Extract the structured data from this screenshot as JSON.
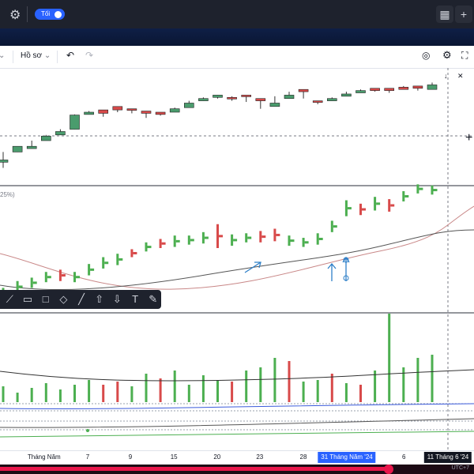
{
  "topbar": {
    "toggle_label": "Tối",
    "gear_icon": "gear-icon",
    "grid_icon": "grid-icon",
    "plus_icon": "plus-icon"
  },
  "toolbar": {
    "profile_label": "Hồ sơ",
    "undo_icon": "undo-icon",
    "redo_icon": "redo-icon"
  },
  "panel_label": "25%)",
  "drawing_tools": [
    "brush-icon",
    "comment-icon",
    "rectangle-icon",
    "diamond-icon",
    "line-icon",
    "arrow-up-icon",
    "arrow-down-icon",
    "text-icon",
    "pen-icon"
  ],
  "xaxis": {
    "labels": [
      {
        "text": "Tháng Năm",
        "pos": 0.093
      },
      {
        "text": "7",
        "pos": 0.185
      },
      {
        "text": "9",
        "pos": 0.275
      },
      {
        "text": "15",
        "pos": 0.367
      },
      {
        "text": "20",
        "pos": 0.458
      },
      {
        "text": "23",
        "pos": 0.548
      },
      {
        "text": "28",
        "pos": 0.64
      },
      {
        "text": "6",
        "pos": 0.852
      }
    ],
    "highlight1": "31 Tháng Năm '24",
    "highlight2": "11 Tháng 6 '24"
  },
  "bottom_text": "UTC+7",
  "colors": {
    "up": "#4caf50",
    "down": "#d84a4a",
    "dark": "#1e222d",
    "accent": "#2962ff",
    "progress": "#e8174b"
  },
  "chart_data": {
    "type": "bar",
    "candles_top": [
      [
        0.12,
        0.16,
        0.02,
        0.3
      ],
      [
        0.3,
        0.4,
        0.32,
        0.36
      ],
      [
        0.36,
        0.4,
        0.44,
        0.5
      ],
      [
        0.5,
        0.58,
        0.54,
        0.6
      ],
      [
        0.6,
        0.66,
        0.64,
        0.7
      ],
      [
        0.7,
        0.95,
        0.72,
        0.96
      ],
      [
        0.96,
        1.0,
        0.98,
        1.02
      ],
      [
        0.98,
        1.04,
        0.92,
        1.0
      ],
      [
        1.04,
        1.1,
        1.0,
        1.02
      ],
      [
        1.04,
        1.06,
        0.98,
        1.0
      ],
      [
        0.98,
        1.02,
        0.9,
        0.96
      ],
      [
        0.96,
        1.0,
        0.94,
        0.98
      ],
      [
        1.0,
        1.06,
        1.04,
        1.08
      ],
      [
        1.08,
        1.16,
        1.14,
        1.2
      ],
      [
        1.2,
        1.24,
        1.22,
        1.26
      ],
      [
        1.26,
        1.3,
        1.24,
        1.3
      ],
      [
        1.26,
        1.26,
        1.2,
        1.28
      ],
      [
        1.28,
        1.3,
        1.18,
        1.2
      ],
      [
        1.2,
        1.24,
        1.06,
        1.1
      ],
      [
        1.1,
        1.16,
        1.12,
        1.28
      ],
      [
        1.24,
        1.3,
        1.28,
        1.36
      ],
      [
        1.36,
        1.4,
        1.24,
        1.26
      ],
      [
        1.18,
        1.2,
        1.14,
        1.2
      ],
      [
        1.2,
        1.24,
        1.22,
        1.26
      ],
      [
        1.28,
        1.32,
        1.3,
        1.36
      ],
      [
        1.34,
        1.38,
        1.36,
        1.4
      ],
      [
        1.38,
        1.42,
        1.36,
        1.4
      ],
      [
        1.38,
        1.42,
        1.34,
        1.38
      ],
      [
        1.4,
        1.44,
        1.4,
        1.46
      ],
      [
        1.42,
        1.46,
        1.38,
        1.42
      ],
      [
        1.4,
        1.48,
        1.42,
        1.52
      ]
    ],
    "candles_top_colors": [
      "g",
      "g",
      "g",
      "g",
      "g",
      "g",
      "g",
      "r",
      "r",
      "r",
      "r",
      "r",
      "g",
      "g",
      "g",
      "g",
      "r",
      "r",
      "r",
      "g",
      "g",
      "r",
      "r",
      "g",
      "g",
      "g",
      "r",
      "r",
      "r",
      "r",
      "g"
    ],
    "hl_bottom": [
      [
        0.1,
        0.3,
        "g"
      ],
      [
        0.22,
        0.42,
        "g"
      ],
      [
        0.3,
        0.48,
        "g"
      ],
      [
        0.4,
        0.58,
        "g"
      ],
      [
        0.42,
        0.62,
        "r"
      ],
      [
        0.4,
        0.58,
        "g"
      ],
      [
        0.52,
        0.72,
        "g"
      ],
      [
        0.64,
        0.84,
        "g"
      ],
      [
        0.7,
        0.9,
        "g"
      ],
      [
        0.84,
        0.98,
        "r"
      ],
      [
        0.94,
        1.1,
        "g"
      ],
      [
        1.0,
        1.16,
        "r"
      ],
      [
        1.02,
        1.22,
        "g"
      ],
      [
        1.06,
        1.22,
        "g"
      ],
      [
        1.08,
        1.28,
        "g"
      ],
      [
        1.0,
        1.42,
        "r"
      ],
      [
        1.04,
        1.24,
        "g"
      ],
      [
        1.1,
        1.26,
        "g"
      ],
      [
        1.1,
        1.3,
        "r"
      ],
      [
        1.12,
        1.34,
        "r"
      ],
      [
        1.04,
        1.22,
        "g"
      ],
      [
        1.02,
        1.18,
        "g"
      ],
      [
        1.06,
        1.26,
        "g"
      ],
      [
        1.28,
        1.48,
        "g"
      ],
      [
        1.56,
        1.84,
        "g"
      ],
      [
        1.58,
        1.78,
        "r"
      ],
      [
        1.66,
        1.9,
        "g"
      ],
      [
        1.64,
        1.86,
        "r"
      ],
      [
        1.82,
        2.0,
        "g"
      ],
      [
        1.96,
        2.12,
        "g"
      ],
      [
        1.94,
        2.1,
        "g"
      ]
    ],
    "volume": [
      [
        20,
        "g"
      ],
      [
        12,
        "g"
      ],
      [
        18,
        "g"
      ],
      [
        24,
        "g"
      ],
      [
        16,
        "g"
      ],
      [
        22,
        "g"
      ],
      [
        28,
        "g"
      ],
      [
        22,
        "r"
      ],
      [
        26,
        "r"
      ],
      [
        20,
        "g"
      ],
      [
        36,
        "g"
      ],
      [
        30,
        "r"
      ],
      [
        40,
        "g"
      ],
      [
        22,
        "g"
      ],
      [
        34,
        "g"
      ],
      [
        28,
        "g"
      ],
      [
        26,
        "r"
      ],
      [
        40,
        "g"
      ],
      [
        44,
        "g"
      ],
      [
        56,
        "g"
      ],
      [
        52,
        "r"
      ],
      [
        26,
        "g"
      ],
      [
        28,
        "g"
      ],
      [
        36,
        "r"
      ],
      [
        24,
        "g"
      ],
      [
        22,
        "r"
      ],
      [
        40,
        "g"
      ],
      [
        112,
        "g"
      ],
      [
        44,
        "g"
      ],
      [
        56,
        "g"
      ],
      [
        60,
        "g"
      ]
    ]
  }
}
